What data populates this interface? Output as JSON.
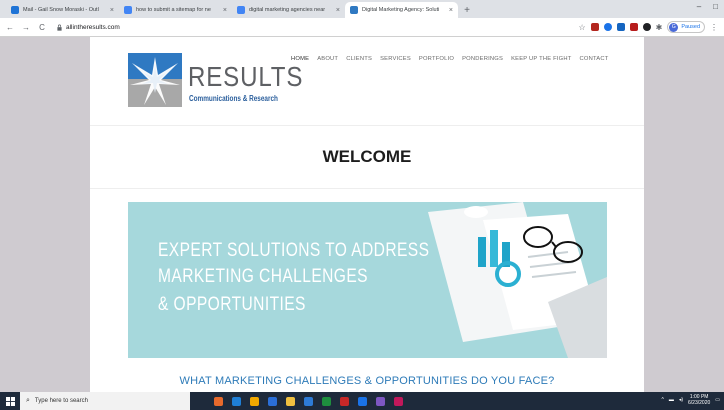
{
  "browser": {
    "tabs": [
      {
        "title": "Mail - Gail Snow Moraski - Outl",
        "favicon_color": "#1e73d6",
        "active": false
      },
      {
        "title": "how to submit a sitemap for ne",
        "favicon_color": "#4285f4",
        "active": false
      },
      {
        "title": "digital marketing agencies near",
        "favicon_color": "#4285f4",
        "active": false
      },
      {
        "title": "Digital Marketing Agency: Soluti",
        "favicon_color": "#2f79c2",
        "active": true
      }
    ],
    "new_tab_icon": "+",
    "window_controls": [
      "–",
      "□"
    ],
    "nav": {
      "back": "←",
      "forward": "→",
      "reload": "C"
    },
    "url": "allintheresults.com",
    "profile_initial": "G",
    "profile_status": "Paused",
    "extension_colors": [
      "#b3261e",
      "#1a73e8",
      "#1565c0",
      "#b71c1c",
      "#202124",
      "#5f6368"
    ]
  },
  "site": {
    "logo": {
      "word": "RESULTS",
      "tagline": "Communications & Research"
    },
    "menu": [
      "HOME",
      "ABOUT",
      "CLIENTS",
      "SERVICES",
      "PORTFOLIO",
      "PONDERINGS",
      "KEEP UP THE FIGHT",
      "CONTACT"
    ],
    "active_menu": "HOME",
    "heading": "WELCOME",
    "hero": {
      "lines": [
        "EXPERT SOLUTIONS TO ADDRESS",
        "MARKETING CHALLENGES",
        "& OPPORTUNITIES"
      ],
      "background": "#a6d8dc"
    },
    "question": "WHAT MARKETING CHALLENGES & OPPORTUNITIES DO YOU FACE?"
  },
  "taskbar": {
    "search_placeholder": "Type here to search",
    "app_colors": [
      "#e86a2c",
      "#1f7fd6",
      "#f2a900",
      "#2b6fd8",
      "#f0c040",
      "#2e7bd6",
      "#1e8e3e",
      "#c62828",
      "#1a73e8",
      "#7e57c2",
      "#c2185b"
    ],
    "time": "1:00 PM",
    "date": "6/23/2020"
  }
}
